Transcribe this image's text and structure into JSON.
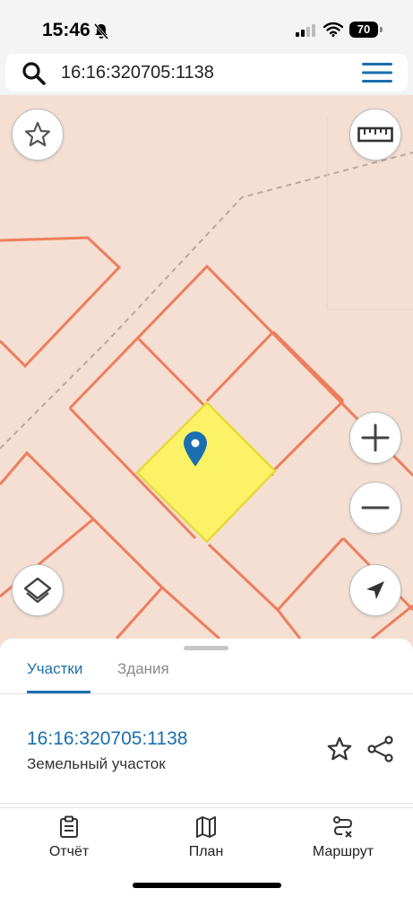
{
  "status_bar": {
    "time": "15:46",
    "battery": "70",
    "icons": [
      "bell-muted-icon",
      "signal-icon",
      "wifi-icon",
      "battery-icon"
    ]
  },
  "search": {
    "value": "16:16:320705:1138",
    "icons": [
      "search-icon",
      "menu-icon"
    ]
  },
  "map": {
    "selected_fill": "#fbf266",
    "parcel_stroke": "#ee7d5c",
    "background": "#f4dfd2",
    "pin_color": "#1b6fb0",
    "controls": [
      "favorite-star-icon",
      "ruler-icon",
      "zoom-in-icon",
      "zoom-out-icon",
      "layers-icon",
      "locate-arrow-icon"
    ]
  },
  "sheet": {
    "tabs": [
      {
        "label": "Участки",
        "active": true
      },
      {
        "label": "Здания",
        "active": false
      }
    ],
    "item": {
      "id": "16:16:320705:1138",
      "type": "Земельный участок"
    }
  },
  "bottom_nav": {
    "items": [
      {
        "label": "Отчёт",
        "icon": "report-icon"
      },
      {
        "label": "План",
        "icon": "map-plan-icon"
      },
      {
        "label": "Маршрут",
        "icon": "route-icon"
      }
    ]
  },
  "accent_color": "#1a6fae"
}
